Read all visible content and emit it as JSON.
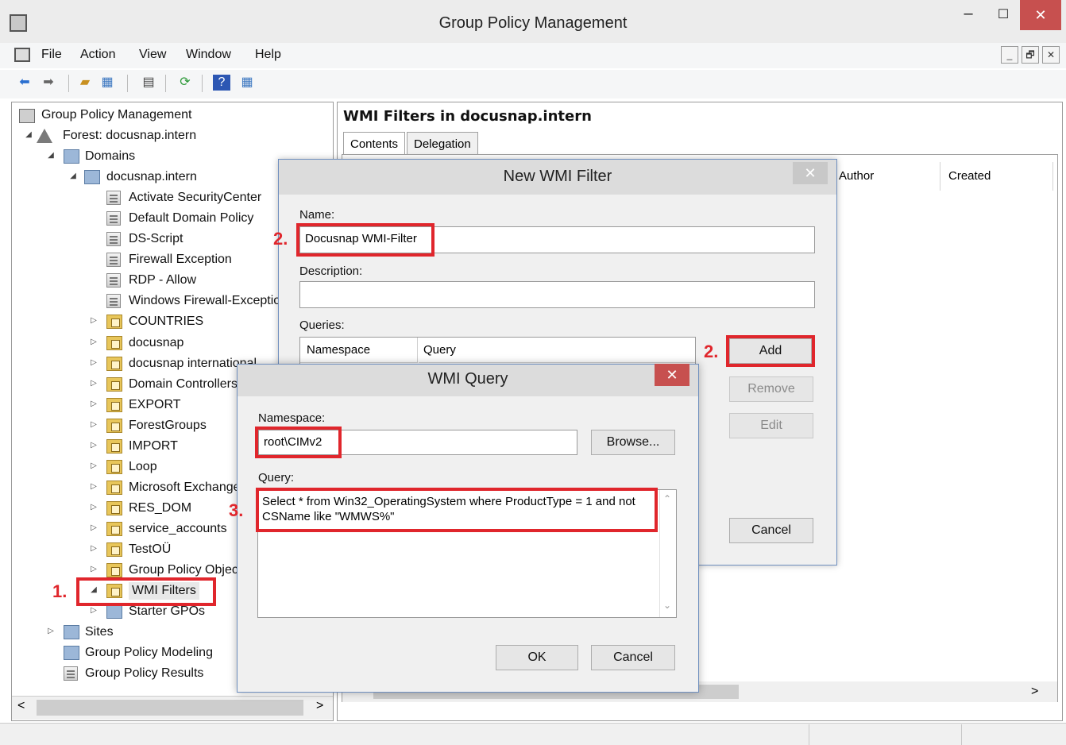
{
  "window": {
    "title": "Group Policy Management",
    "min": "–",
    "max": "☐",
    "close": "✕"
  },
  "menu": [
    "File",
    "Action",
    "View",
    "Window",
    "Help"
  ],
  "mdi": [
    "_",
    "🗗",
    "✕"
  ],
  "tree": {
    "root": "Group Policy Management",
    "forest": "Forest: docusnap.intern",
    "domains": "Domains",
    "domain": "docusnap.intern",
    "gpos": [
      "Activate SecurityCenter",
      "Default Domain Policy",
      "DS-Script",
      "Firewall Exception",
      "RDP - Allow",
      "Windows Firewall-Exception"
    ],
    "ous": [
      "COUNTRIES",
      "docusnap",
      "docusnap international",
      "Domain Controllers",
      "EXPORT",
      "ForestGroups",
      "IMPORT",
      "Loop",
      "Microsoft Exchange",
      "RES_DOM",
      "service_accounts",
      "TestOÜ",
      "Group Policy Objects"
    ],
    "wmi_filters": "WMI Filters",
    "starter_gpos": "Starter GPOs",
    "sites": "Sites",
    "modeling": "Group Policy Modeling",
    "results": "Group Policy Results",
    "scroll_left": "<",
    "scroll_right": ">"
  },
  "right": {
    "title": "WMI Filters in docusnap.intern",
    "tabs": [
      "Contents",
      "Delegation"
    ],
    "columns": [
      "Author",
      "Created"
    ],
    "scroll_left": "<",
    "scroll_right": ">"
  },
  "filter_dialog": {
    "title": "New WMI Filter",
    "close": "✕",
    "name_label": "Name:",
    "name_value": "Docusnap WMI-Filter",
    "description_label": "Description:",
    "description_value": "",
    "queries_label": "Queries:",
    "columns": [
      "Namespace",
      "Query"
    ],
    "add": "Add",
    "remove": "Remove",
    "edit": "Edit",
    "cancel": "Cancel"
  },
  "query_dialog": {
    "title": "WMI Query",
    "close": "✕",
    "namespace_label": "Namespace:",
    "namespace_value": "root\\CIMv2",
    "browse": "Browse...",
    "query_label": "Query:",
    "query_value": "Select * from Win32_OperatingSystem where ProductType = 1 and not\nCSName like \"WMWS%\"",
    "ok": "OK",
    "cancel": "Cancel"
  },
  "annotations": {
    "step1": "1.",
    "step2a": "2.",
    "step2b": "2.",
    "step3": "3.",
    "color": "#e0262c"
  }
}
